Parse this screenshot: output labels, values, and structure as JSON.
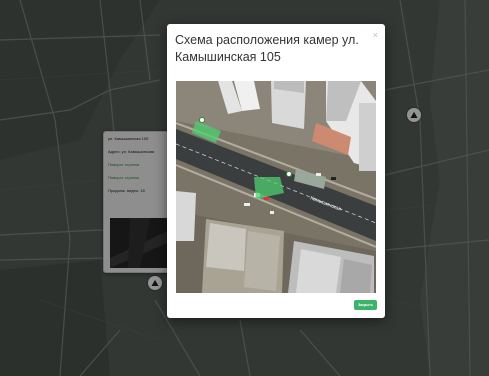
{
  "modal": {
    "title": "Схема расположения камер ул. Камышинская 105",
    "close_symbol": "×",
    "close_button_label": "Закрыть",
    "image_street_label": "Камышинская"
  },
  "popup": {
    "line1": "ул. Камышинская 105",
    "line2": "Адрес: ул. Камышинская",
    "line3": "Поворот стрелки",
    "line4": "Поворот стрелки",
    "line5": "Продолж. видео: 18"
  },
  "markers": {
    "glyph": "⛰"
  },
  "colors": {
    "accent_green": "#3cb36a",
    "overlay": "rgba(0,0,0,0.42)"
  }
}
